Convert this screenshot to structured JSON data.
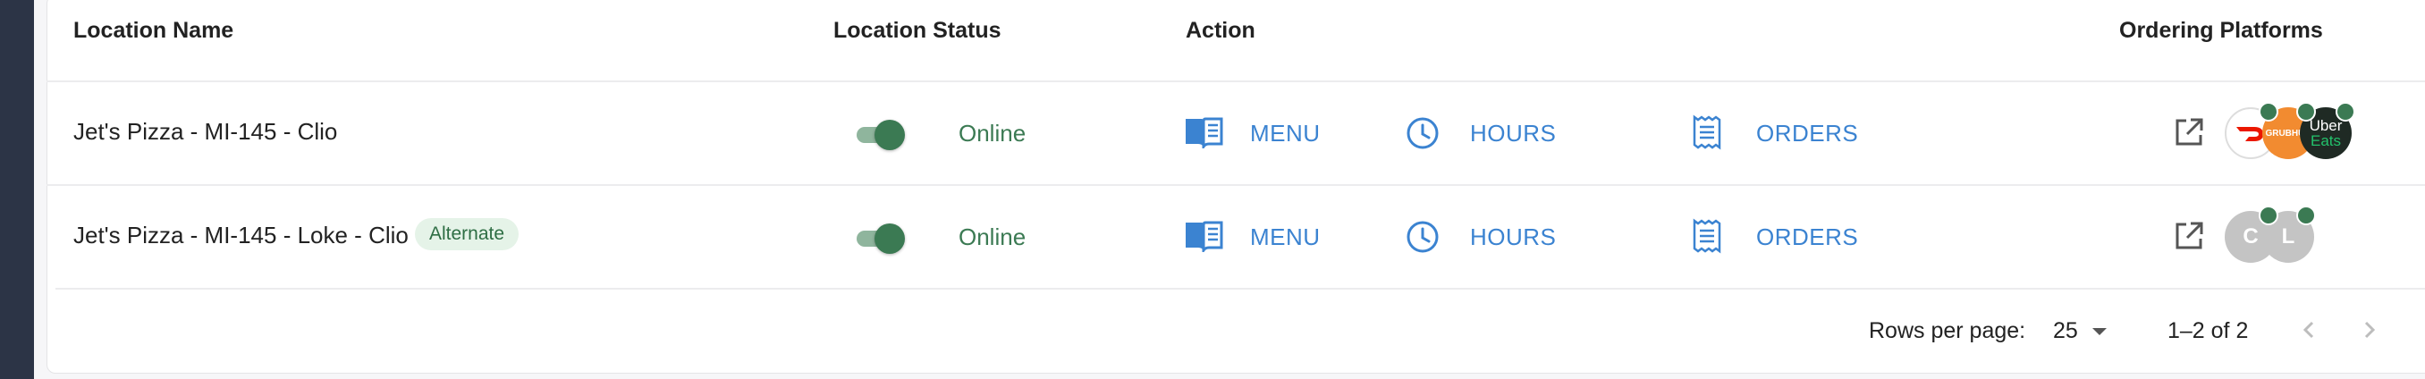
{
  "table": {
    "headers": {
      "location_name": "Location Name",
      "location_status": "Location Status",
      "action": "Action",
      "ordering_platforms": "Ordering Platforms"
    },
    "rows": [
      {
        "name": "Jet's Pizza - MI-145 - Clio",
        "badge": "",
        "status_on": true,
        "status": "Online",
        "actions": {
          "menu": "MENU",
          "hours": "HOURS",
          "orders": "ORDERS"
        },
        "platforms": [
          {
            "icon": "doordash-logo",
            "label": ""
          },
          {
            "icon": "grubhub-logo",
            "label": "GRUBHUB"
          },
          {
            "icon": "uber-eats-logo",
            "label": "Uber",
            "label2": "Eats"
          }
        ]
      },
      {
        "name": "Jet's Pizza - MI-145 - Loke - Clio",
        "badge": "Alternate",
        "status_on": true,
        "status": "Online",
        "actions": {
          "menu": "MENU",
          "hours": "HOURS",
          "orders": "ORDERS"
        },
        "platforms": [
          {
            "icon": "platform-c-avatar",
            "label": "C"
          },
          {
            "icon": "platform-l-avatar",
            "label": "L"
          }
        ]
      }
    ]
  },
  "pagination": {
    "rows_per_page_label": "Rows per page:",
    "rows_per_page_value": "25",
    "range": "1–2 of 2"
  },
  "colors": {
    "accent_blue": "#3b83d1",
    "online_green": "#3b7a53",
    "badge_bg": "#e5f3e8",
    "sidebar": "#2c3446"
  }
}
